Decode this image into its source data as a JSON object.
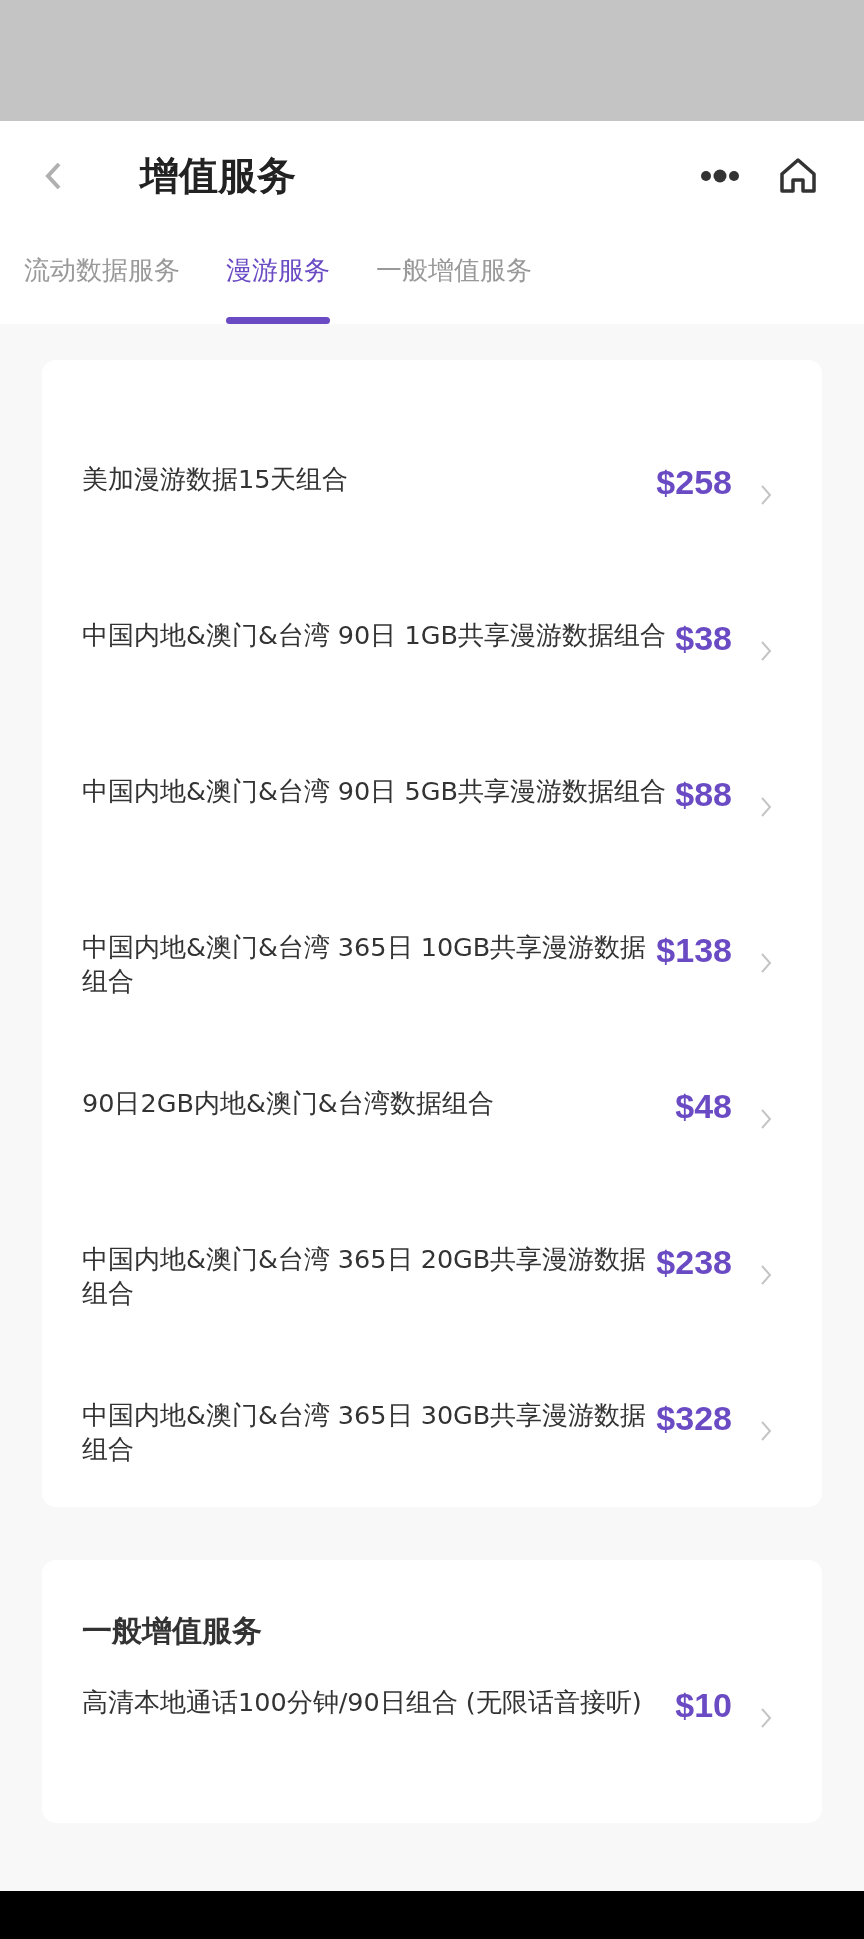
{
  "header": {
    "title": "增值服务"
  },
  "tabs": [
    {
      "label": "流动数据服务",
      "selected": false
    },
    {
      "label": "漫游服务",
      "selected": true
    },
    {
      "label": "一般增值服务",
      "selected": false
    }
  ],
  "roaming_items": [
    {
      "name": "美加漫游数据15天组合",
      "price": "$258"
    },
    {
      "name": "中国内地&澳门&台湾 90日 1GB共享漫游数据组合",
      "price": "$38"
    },
    {
      "name": "中国内地&澳门&台湾 90日 5GB共享漫游数据组合",
      "price": "$88"
    },
    {
      "name": "中国内地&澳门&台湾 365日 10GB共享漫游数据组合",
      "price": "$138"
    },
    {
      "name": "90日2GB内地&澳门&台湾数据组合",
      "price": "$48"
    },
    {
      "name": "中国内地&澳门&台湾 365日 20GB共享漫游数据组合",
      "price": "$238"
    },
    {
      "name": "中国内地&澳门&台湾 365日 30GB共享漫游数据组合",
      "price": "$328"
    }
  ],
  "general_section": {
    "title": "一般增值服务",
    "items": [
      {
        "name": "高清本地通话100分钟/90日组合 (无限话音接听)",
        "price": "$10"
      }
    ]
  }
}
